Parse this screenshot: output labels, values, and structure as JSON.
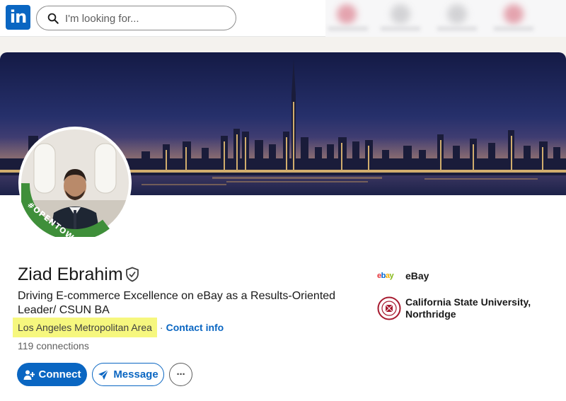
{
  "search": {
    "placeholder": "I'm looking for..."
  },
  "profile": {
    "name": "Ziad Ebrahim",
    "headline": "Driving E-commerce Excellence on eBay as a Results-Oriented Leader/ CSUN BA",
    "location": "Los Angeles Metropolitan Area",
    "separator": "·",
    "contact_info_label": "Contact info",
    "connections": "119 connections",
    "open_to_work_badge": "#OPENTOWORK"
  },
  "actions": {
    "connect_label": "Connect",
    "message_label": "Message",
    "more_label": "···"
  },
  "experience": {
    "company": "eBay",
    "company_logo_text": [
      "e",
      "b",
      "a",
      "y"
    ]
  },
  "education": {
    "school": "California State University, Northridge"
  },
  "colors": {
    "brand": "#0a66c2",
    "highlight": "#f6f77e",
    "open_to_work_green": "#2e7d32"
  }
}
